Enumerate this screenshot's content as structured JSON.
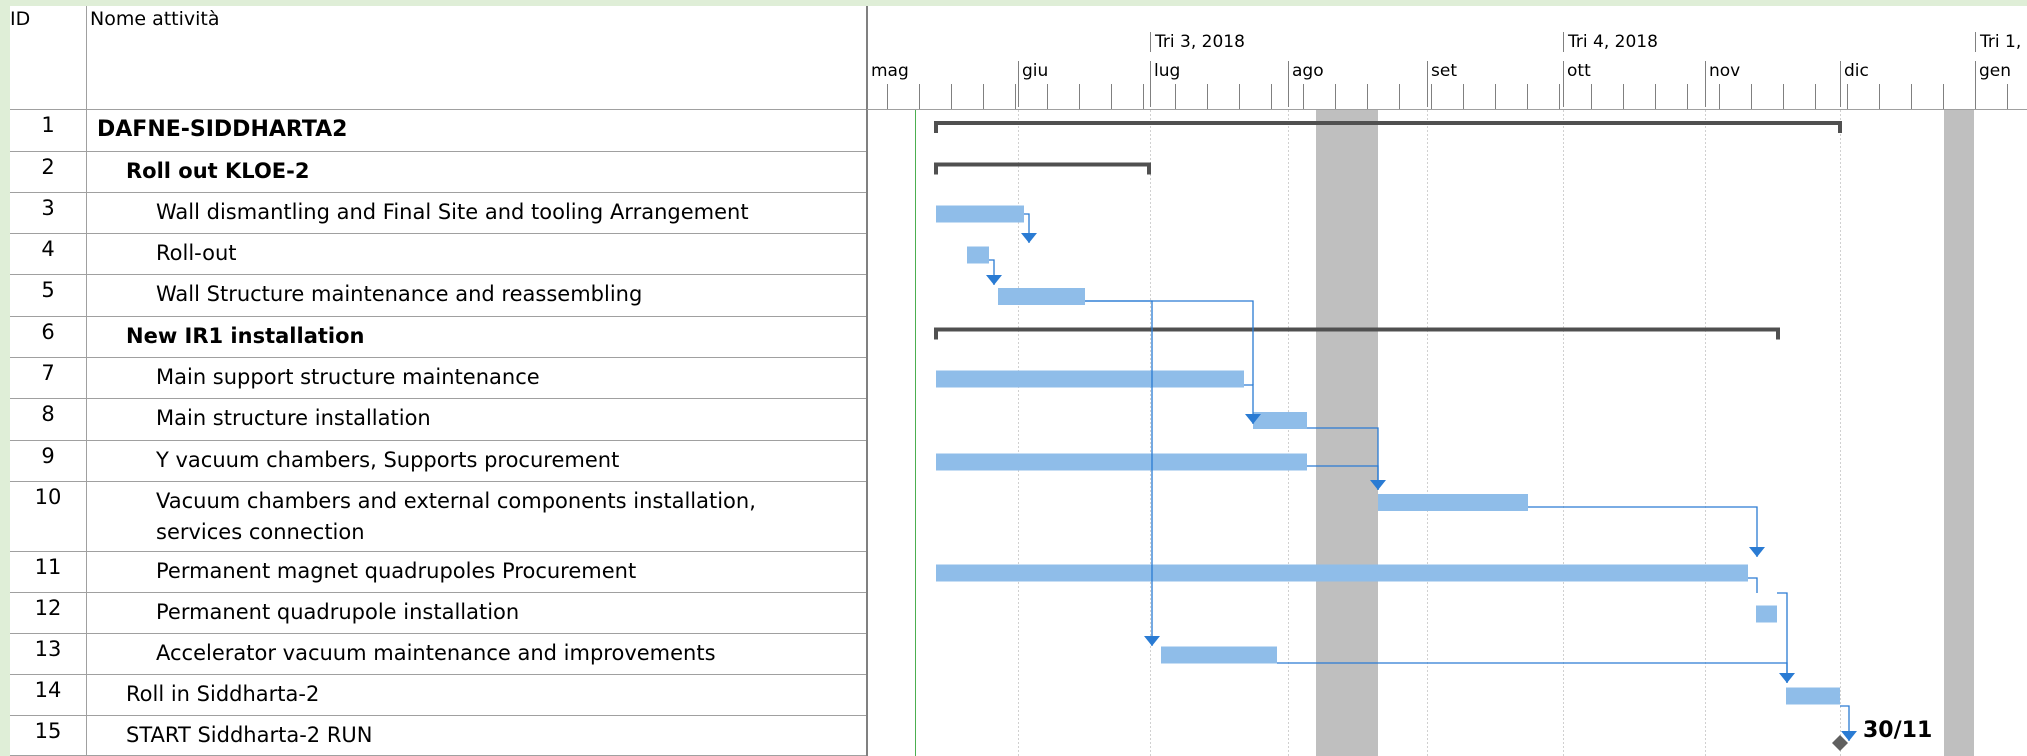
{
  "table": {
    "col_id": "ID",
    "col_name": "Nome attività",
    "rows": [
      {
        "id": "1",
        "name": "DAFNE-SIDDHARTA2",
        "level": 1,
        "summary": true
      },
      {
        "id": "2",
        "name": "Roll out KLOE-2",
        "level": 2,
        "summary": true
      },
      {
        "id": "3",
        "name": "Wall dismantling and Final Site and tooling Arrangement",
        "level": 3
      },
      {
        "id": "4",
        "name": "Roll-out",
        "level": 3
      },
      {
        "id": "5",
        "name": "Wall Structure maintenance and reassembling",
        "level": 3
      },
      {
        "id": "6",
        "name": "New IR1 installation",
        "level": 2,
        "summary": true
      },
      {
        "id": "7",
        "name": "Main support structure maintenance",
        "level": 3
      },
      {
        "id": "8",
        "name": "Main structure installation",
        "level": 3
      },
      {
        "id": "9",
        "name": "Y vacuum chambers, Supports procurement",
        "level": 3
      },
      {
        "id": "10",
        "name": "Vacuum chambers and external components installation,\nservices connection",
        "level": 3
      },
      {
        "id": "11",
        "name": "Permanent magnet quadrupoles Procurement",
        "level": 3
      },
      {
        "id": "12",
        "name": "Permanent quadrupole installation",
        "level": 3
      },
      {
        "id": "13",
        "name": "Accelerator vacuum maintenance and improvements",
        "level": 3
      },
      {
        "id": "14",
        "name": "Roll in Siddharta-2",
        "level": 2
      },
      {
        "id": "15",
        "name": "START Siddharta-2 RUN",
        "level": 2
      }
    ]
  },
  "timescale": {
    "quarters": [
      "Tri 3, 2018",
      "Tri 4, 2018",
      "Tri 1,"
    ],
    "months": [
      "mag",
      "giu",
      "lug",
      "ago",
      "set",
      "ott",
      "nov",
      "dic",
      "gen"
    ]
  },
  "milestone": {
    "label": "30/11"
  },
  "colors": {
    "task_bar": "#8fbde9",
    "summary_bar": "#505050",
    "link": "#2a7bd3",
    "milestone": "#606060",
    "nonworking": "#bfbfbf"
  }
}
